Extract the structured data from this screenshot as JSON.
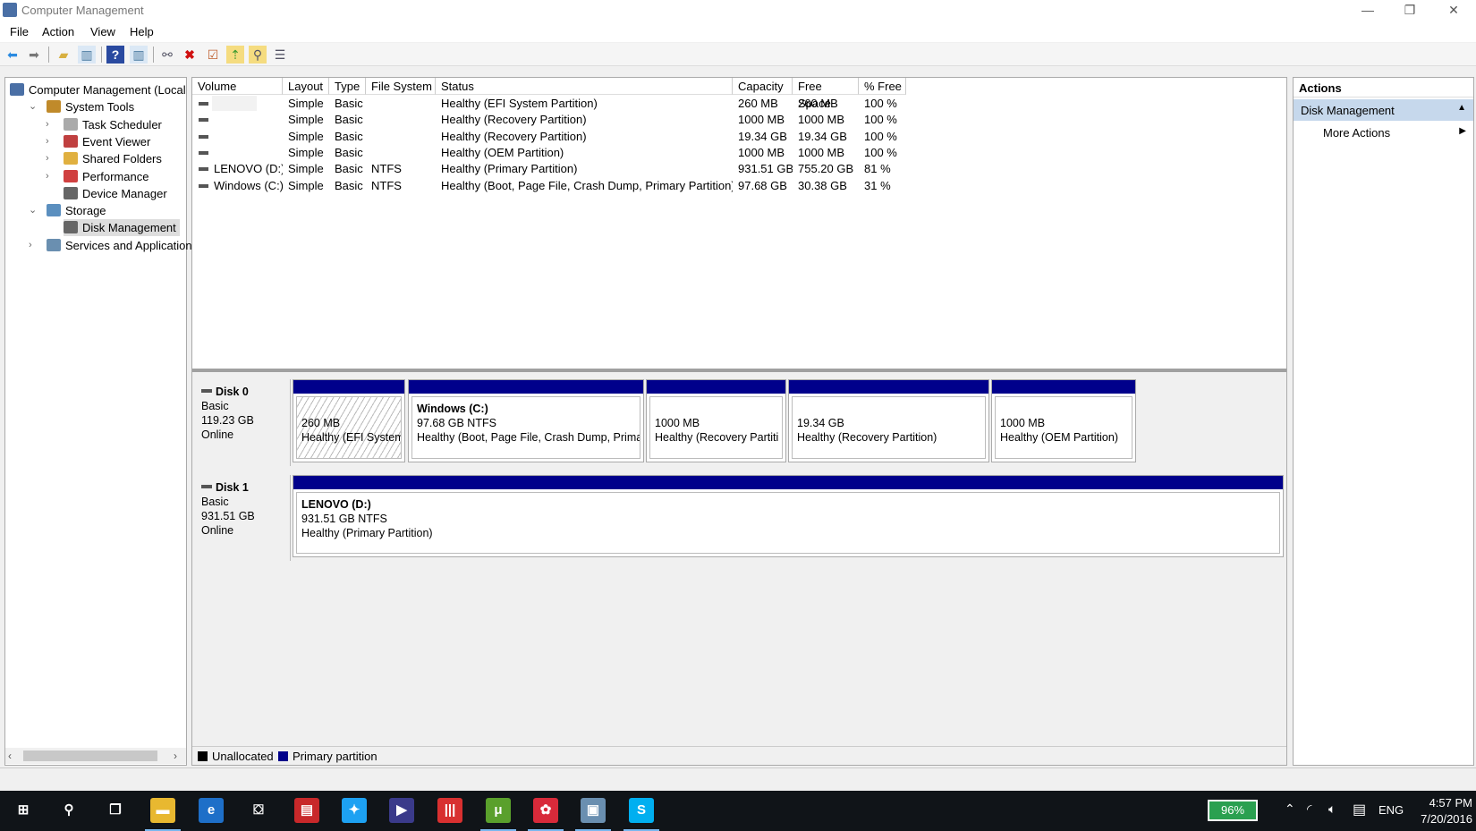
{
  "window": {
    "title": "Computer Management",
    "minimize": "—",
    "restore": "❐",
    "close": "✕"
  },
  "menu": [
    "File",
    "Action",
    "View",
    "Help"
  ],
  "toolbar": {
    "icons": [
      "back-icon",
      "forward-icon",
      "up-folder-icon",
      "show-hide-tree-icon",
      "help-icon",
      "show-action-pane-icon",
      "connect-drive-icon",
      "delete-icon",
      "properties-icon",
      "open-icon",
      "search-icon",
      "list-icon"
    ]
  },
  "tree": [
    {
      "label": "Computer Management (Local",
      "level": 0,
      "arrow": "",
      "color": "#4a6fa5"
    },
    {
      "label": "System Tools",
      "level": 1,
      "arrow": "⌄",
      "color": "#c08a2a"
    },
    {
      "label": "Task Scheduler",
      "level": 2,
      "arrow": "›",
      "color": "#aaaaaa"
    },
    {
      "label": "Event Viewer",
      "level": 2,
      "arrow": "›",
      "color": "#c04040"
    },
    {
      "label": "Shared Folders",
      "level": 2,
      "arrow": "›",
      "color": "#e0b040"
    },
    {
      "label": "Performance",
      "level": 2,
      "arrow": "›",
      "color": "#d04040"
    },
    {
      "label": "Device Manager",
      "level": 2,
      "arrow": "",
      "color": "#666666"
    },
    {
      "label": "Storage",
      "level": 1,
      "arrow": "⌄",
      "color": "#5b8fbf"
    },
    {
      "label": "Disk Management",
      "level": 2,
      "arrow": "",
      "color": "#666666",
      "selected": true
    },
    {
      "label": "Services and Applications",
      "level": 1,
      "arrow": "›",
      "color": "#6a8fb0"
    }
  ],
  "table": {
    "columns": [
      "Volume",
      "Layout",
      "Type",
      "File System",
      "Status",
      "Capacity",
      "Free Space",
      "% Free"
    ],
    "rows": [
      [
        "",
        "Simple",
        "Basic",
        "",
        "Healthy (EFI System Partition)",
        "260 MB",
        "260 MB",
        "100 %"
      ],
      [
        "",
        "Simple",
        "Basic",
        "",
        "Healthy (Recovery Partition)",
        "1000 MB",
        "1000 MB",
        "100 %"
      ],
      [
        "",
        "Simple",
        "Basic",
        "",
        "Healthy (Recovery Partition)",
        "19.34 GB",
        "19.34 GB",
        "100 %"
      ],
      [
        "",
        "Simple",
        "Basic",
        "",
        "Healthy (OEM Partition)",
        "1000 MB",
        "1000 MB",
        "100 %"
      ],
      [
        "LENOVO (D:)",
        "Simple",
        "Basic",
        "NTFS",
        "Healthy (Primary Partition)",
        "931.51 GB",
        "755.20 GB",
        "81 %"
      ],
      [
        "Windows (C:)",
        "Simple",
        "Basic",
        "NTFS",
        "Healthy (Boot, Page File, Crash Dump, Primary Partition)",
        "97.68 GB",
        "30.38 GB",
        "31 %"
      ]
    ]
  },
  "disks": [
    {
      "name": "Disk 0",
      "type": "Basic",
      "size": "119.23 GB",
      "status": "Online",
      "partitions": [
        {
          "title": "",
          "size": "260 MB",
          "status": "Healthy (EFI System",
          "hatched": true
        },
        {
          "title": "Windows  (C:)",
          "size": "97.68 GB NTFS",
          "status": "Healthy (Boot, Page File, Crash Dump, Prima"
        },
        {
          "title": "",
          "size": "1000 MB",
          "status": "Healthy (Recovery Partiti"
        },
        {
          "title": "",
          "size": "19.34 GB",
          "status": "Healthy (Recovery Partition)"
        },
        {
          "title": "",
          "size": "1000 MB",
          "status": "Healthy (OEM Partition)"
        }
      ]
    },
    {
      "name": "Disk 1",
      "type": "Basic",
      "size": "931.51 GB",
      "status": "Online",
      "partitions": [
        {
          "title": "LENOVO  (D:)",
          "size": "931.51 GB NTFS",
          "status": "Healthy (Primary Partition)"
        }
      ]
    }
  ],
  "legend": [
    {
      "label": "Unallocated",
      "color": "#000000"
    },
    {
      "label": "Primary partition",
      "color": "#00008b"
    }
  ],
  "actions": {
    "header": "Actions",
    "section": "Disk Management",
    "more": "More Actions"
  },
  "taskbar": {
    "apps": [
      {
        "name": "start-icon",
        "glyph": "⊞",
        "color": "transparent"
      },
      {
        "name": "search-icon",
        "glyph": "⚲",
        "color": "transparent"
      },
      {
        "name": "task-view-icon",
        "glyph": "❐",
        "color": "transparent"
      },
      {
        "name": "file-explorer-icon",
        "glyph": "▬",
        "color": "#e8b830",
        "active": true
      },
      {
        "name": "edge-icon",
        "glyph": "e",
        "color": "#1e6fc8"
      },
      {
        "name": "store-icon",
        "glyph": "⛋",
        "color": "transparent"
      },
      {
        "name": "reader-icon",
        "glyph": "▤",
        "color": "#c8282a"
      },
      {
        "name": "twitter-icon",
        "glyph": "✦",
        "color": "#1da1f2"
      },
      {
        "name": "movie-icon",
        "glyph": "▶",
        "color": "#3a3a8a"
      },
      {
        "name": "media-app-icon",
        "glyph": "|||",
        "color": "#d83030"
      },
      {
        "name": "utorrent-icon",
        "glyph": "μ",
        "color": "#5aa02c",
        "active": true
      },
      {
        "name": "app-red-icon",
        "glyph": "✿",
        "color": "#d82a3a",
        "active": true
      },
      {
        "name": "computer-management-icon",
        "glyph": "▣",
        "color": "#6a8fb0",
        "active": true
      },
      {
        "name": "skype-icon",
        "glyph": "S",
        "color": "#00aff0",
        "active": true
      }
    ],
    "battery": "96%",
    "lang": "ENG",
    "time": "4:57 PM",
    "date": "7/20/2016"
  }
}
